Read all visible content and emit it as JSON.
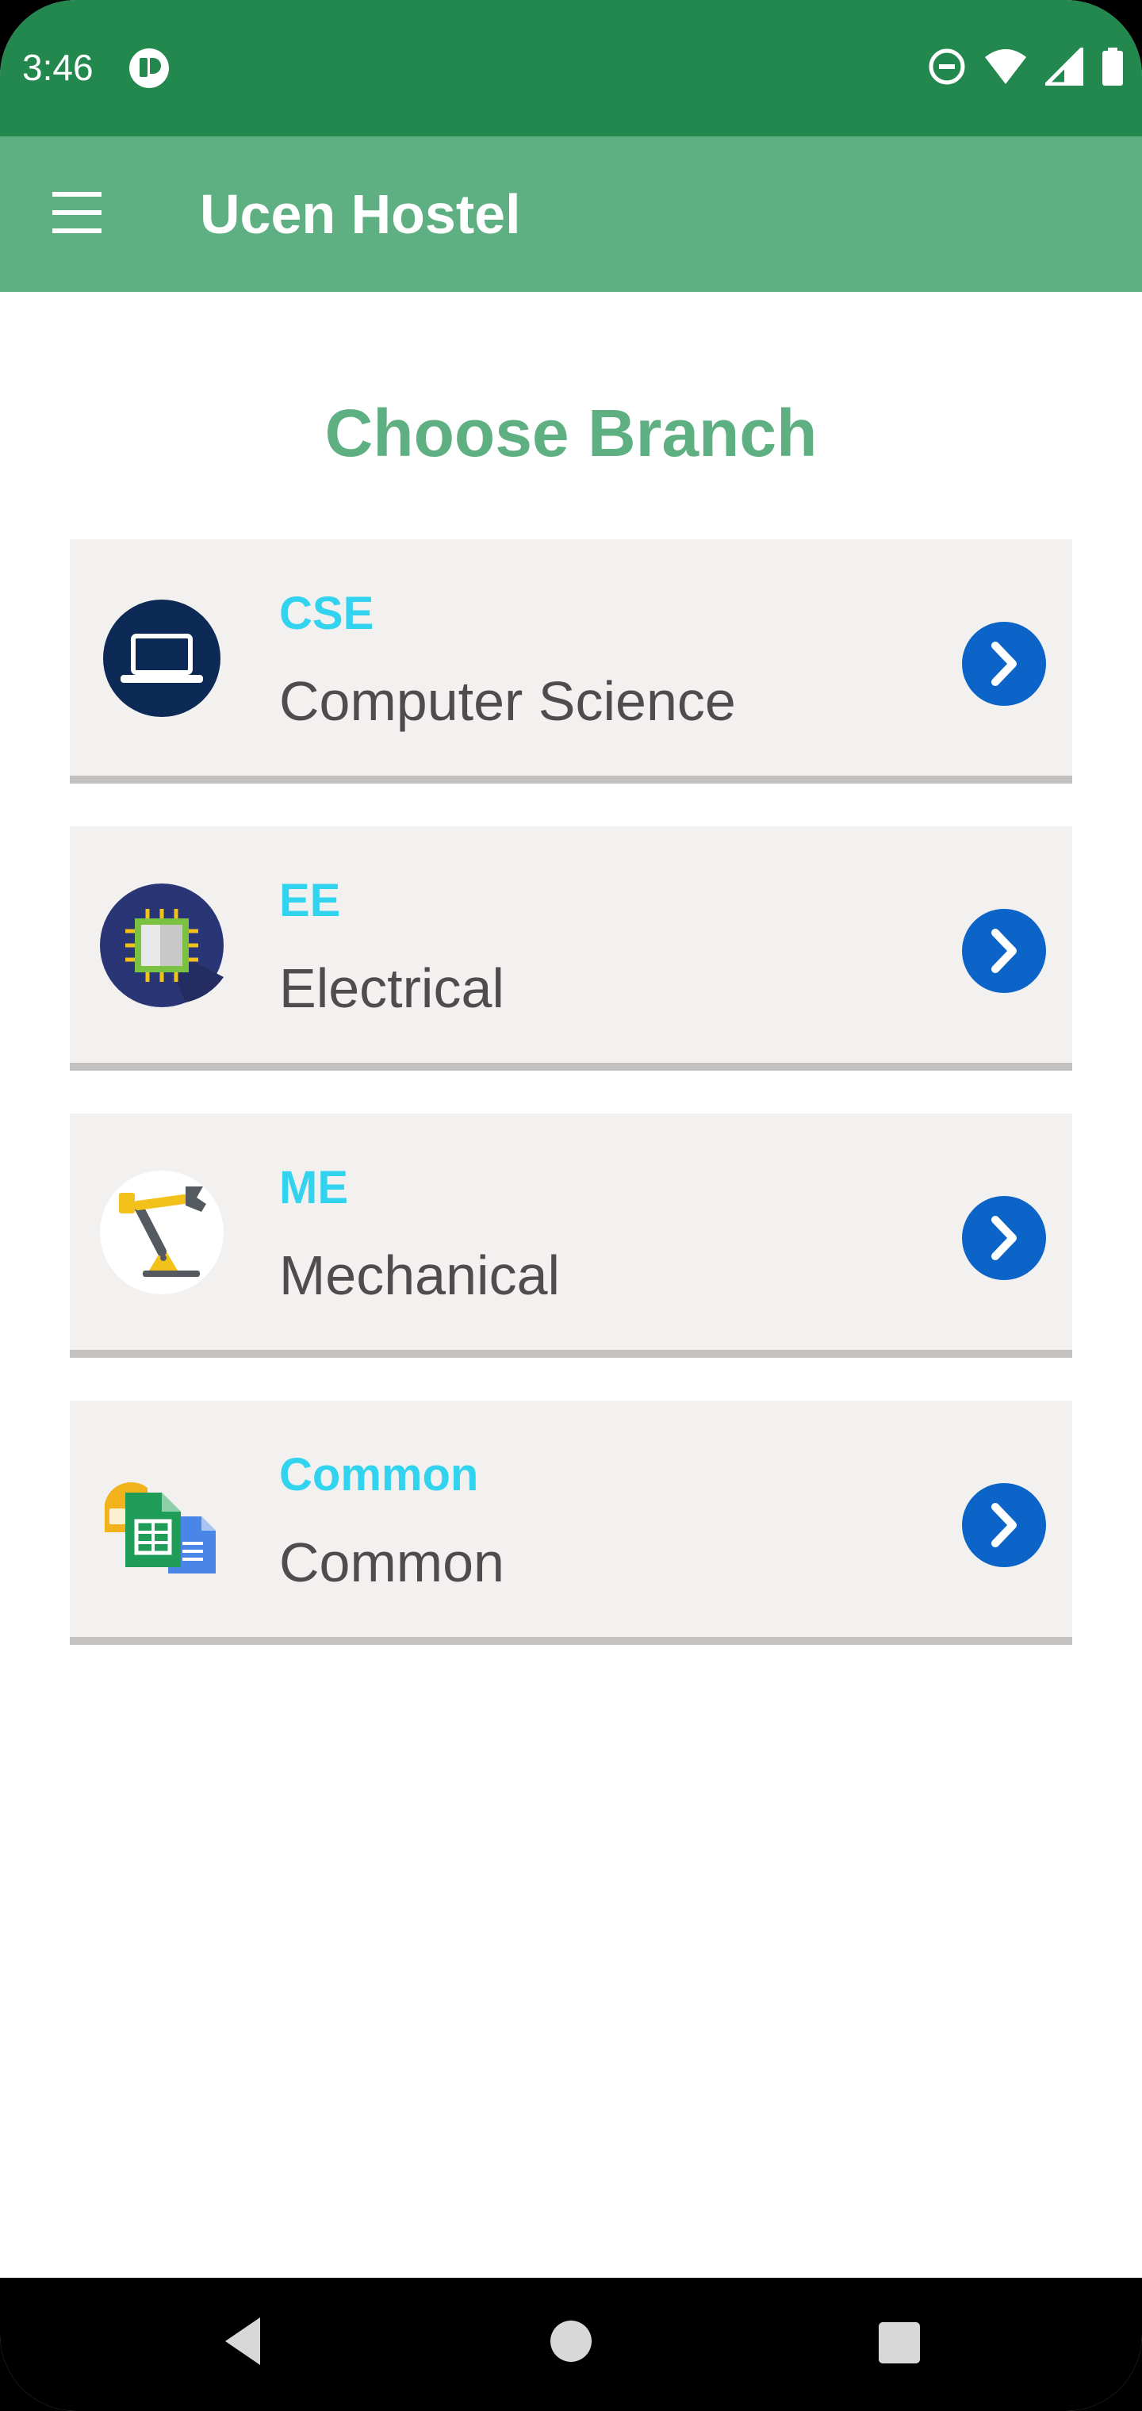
{
  "status_bar": {
    "time": "3:46",
    "color": "#23884d",
    "icons": [
      "app-notification-icon",
      "do-not-disturb-icon",
      "wifi-icon",
      "signal-icon",
      "battery-icon"
    ]
  },
  "app_bar": {
    "title": "Ucen Hostel",
    "menu_icon": "hamburger-menu-icon",
    "color": "#5eb082"
  },
  "page": {
    "heading": "Choose Branch"
  },
  "branches": [
    {
      "code": "CSE",
      "name": "Computer Science",
      "icon": "laptop-icon"
    },
    {
      "code": "EE",
      "name": "Electrical",
      "icon": "microchip-icon"
    },
    {
      "code": "ME",
      "name": "Mechanical",
      "icon": "robotic-arm-icon"
    },
    {
      "code": "Common",
      "name": "Common",
      "icon": "documents-icon"
    }
  ],
  "colors": {
    "code_text": "#31d3ef",
    "name_text": "#4e4c4c",
    "card_background": "#f3f1f0",
    "arrow_button": "#0c63c8"
  },
  "nav_bar": {
    "icons": [
      "back-icon",
      "home-icon",
      "recents-icon"
    ]
  }
}
